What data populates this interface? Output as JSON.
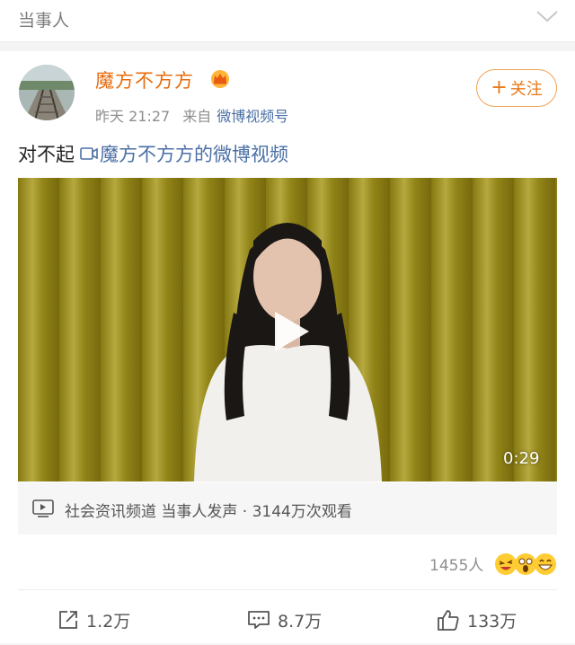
{
  "header": {
    "title": "当事人"
  },
  "post": {
    "author": "魔方不方方",
    "time": "昨天 21:27",
    "from_label": "来自",
    "source": "微博视频号",
    "follow_label": "关注",
    "text": "对不起",
    "video_link_text": "魔方不方方的微博视频"
  },
  "video": {
    "duration": "0:29",
    "channel_text": "社会资讯频道 当事人发声 · 3144万次观看"
  },
  "reactions": {
    "count": "1455人"
  },
  "actions": {
    "share": "1.2万",
    "comment": "8.7万",
    "like": "133万"
  },
  "colors": {
    "accent": "#e86b0c",
    "link": "#4a6fa5",
    "curtain": "#a79a22"
  }
}
